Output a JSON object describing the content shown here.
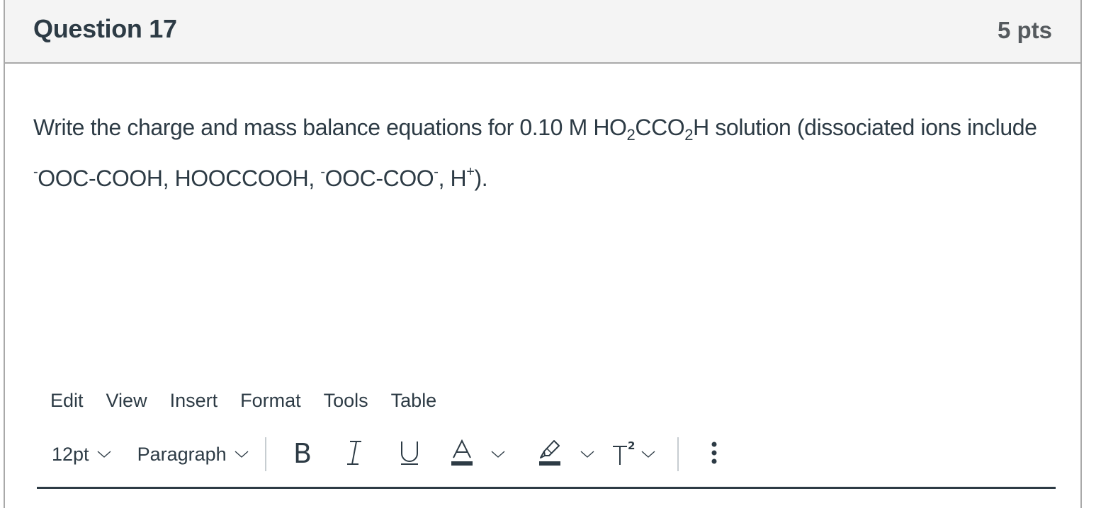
{
  "question": {
    "title": "Question 17",
    "points": "5 pts",
    "text": {
      "line1_prefix": "Write the charge and mass balance equations for 0.10 M HO",
      "sub1": "2",
      "mid1": "CCO",
      "sub2": "2",
      "line1_suffix": "H solution (dissociated ions include",
      "sup_minus1": "-",
      "ion1": "OOC-COOH, HOOCCOOH, ",
      "sup_minus2": "-",
      "ion2": "OOC-COO",
      "sup_minus3": "-",
      "ion3": ", H",
      "sup_plus": "+",
      "end": ")."
    }
  },
  "editor": {
    "menu": [
      "Edit",
      "View",
      "Insert",
      "Format",
      "Tools",
      "Table"
    ],
    "toolbar": {
      "font_size": "12pt",
      "block_format": "Paragraph",
      "bold_icon": "bold-icon",
      "italic_icon": "italic-icon",
      "underline_icon": "underline-icon",
      "text_color_icon": "text-color-icon",
      "highlight_icon": "highlight-icon",
      "superscript_icon": "superscript-icon",
      "more_icon": "more-vertical-icon"
    }
  },
  "colors": {
    "text": "#2d3b45",
    "header_bg": "#f4f4f4",
    "border": "#a9a9a9",
    "points": "#555a5e"
  }
}
